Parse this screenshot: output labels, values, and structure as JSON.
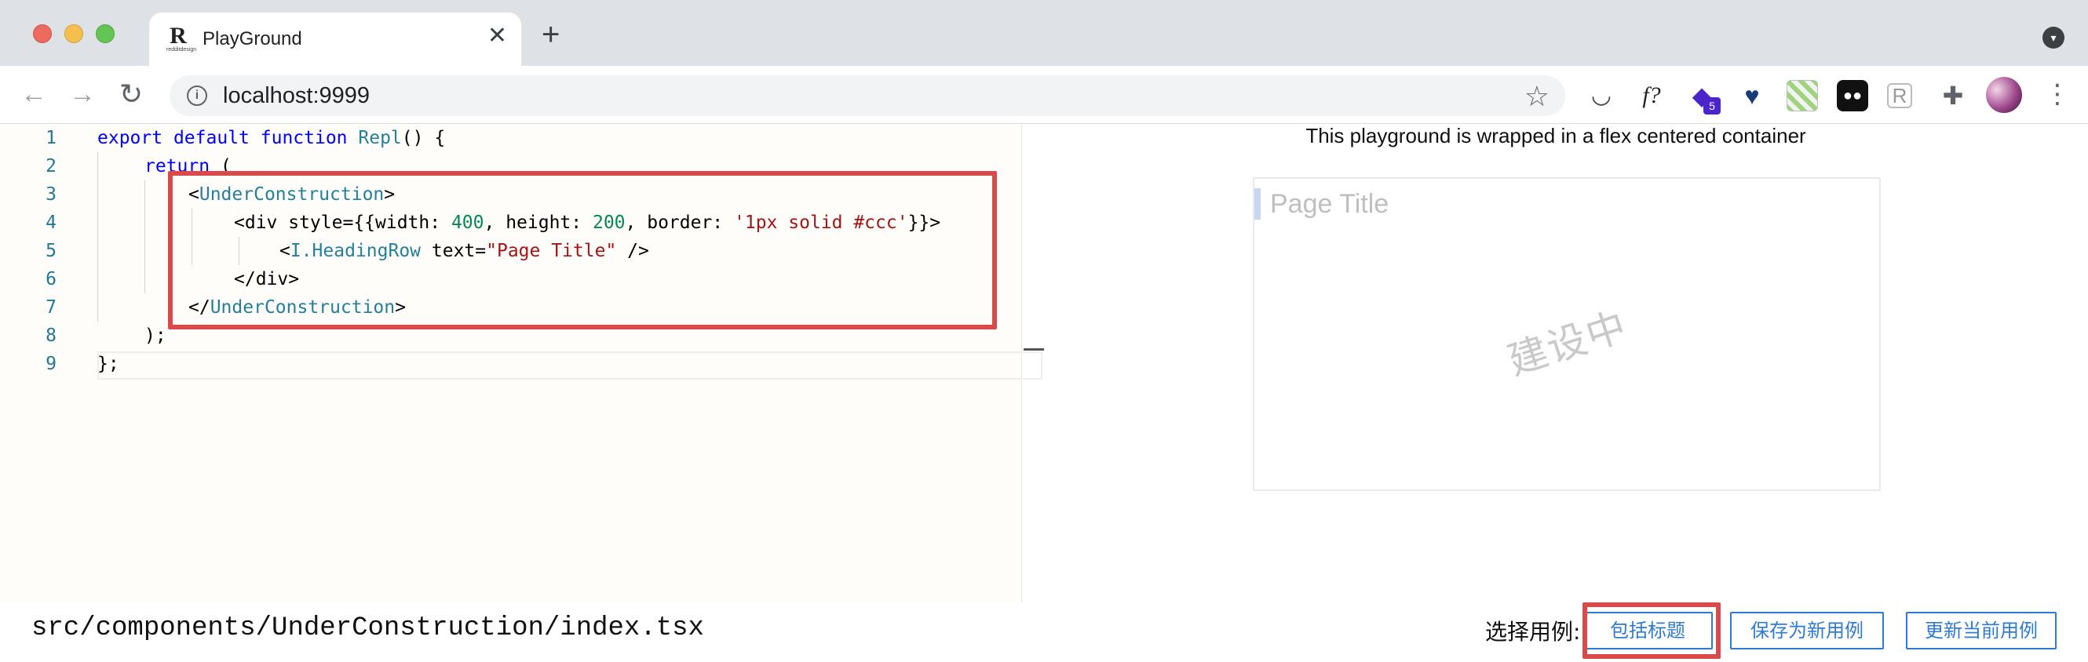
{
  "browser": {
    "tab_title": "PlayGround",
    "favicon_letter": "R",
    "favicon_caption": "redditdesign",
    "close_glyph": "✕",
    "new_tab_glyph": "+",
    "url": "localhost:9999"
  },
  "toolbar": {
    "back_glyph": "←",
    "forward_glyph": "→",
    "reload_glyph": "↻",
    "info_glyph": "i",
    "star_glyph": "☆",
    "extensions": {
      "pocket_glyph": "◡",
      "fx_label": "f?",
      "stack_glyph": "◆",
      "stack_badge": "5",
      "heart_glyph": "♥",
      "mask_glyph": "●●",
      "r_label": "R",
      "puzzle_glyph": "✚"
    },
    "menu_glyph": "⋮"
  },
  "editor": {
    "line_numbers": [
      "1",
      "2",
      "3",
      "4",
      "5",
      "6",
      "7",
      "8",
      "9"
    ],
    "lines": {
      "l1": {
        "kw1": "export",
        "kw2": "default",
        "kw3": "function",
        "fn": "Repl",
        "rest": "() {"
      },
      "l2": {
        "kw": "return",
        "rest": " ("
      },
      "l3": {
        "open": "<",
        "tag": "UnderConstruction",
        "close": ">"
      },
      "l4": {
        "a": "<div style={{width: ",
        "n1": "400",
        "b": ", height: ",
        "n2": "200",
        "c": ", border: ",
        "s": "'1px solid #ccc'",
        "d": "}}>"
      },
      "l5": {
        "a": "<",
        "tag": "I.HeadingRow",
        "b": " text=",
        "s": "\"Page Title\"",
        "c": " />"
      },
      "l6": {
        "text": "</div>"
      },
      "l7": {
        "open": "</",
        "tag": "UnderConstruction",
        "close": ">"
      },
      "l8": {
        "text": ");"
      },
      "l9": {
        "text": "};"
      }
    }
  },
  "preview": {
    "caption": "This playground is wrapped in a flex centered container",
    "heading": "Page Title",
    "watermark": "建设中"
  },
  "footer": {
    "file_path": "src/components/UnderConstruction/index.tsx",
    "pick_label": "选择用例:",
    "buttons": {
      "include_title": "包括标题",
      "save_new": "保存为新用例",
      "update_current": "更新当前用例"
    }
  },
  "colors": {
    "highlight": "#d94b4b",
    "button_accent": "#2e7bd1"
  }
}
